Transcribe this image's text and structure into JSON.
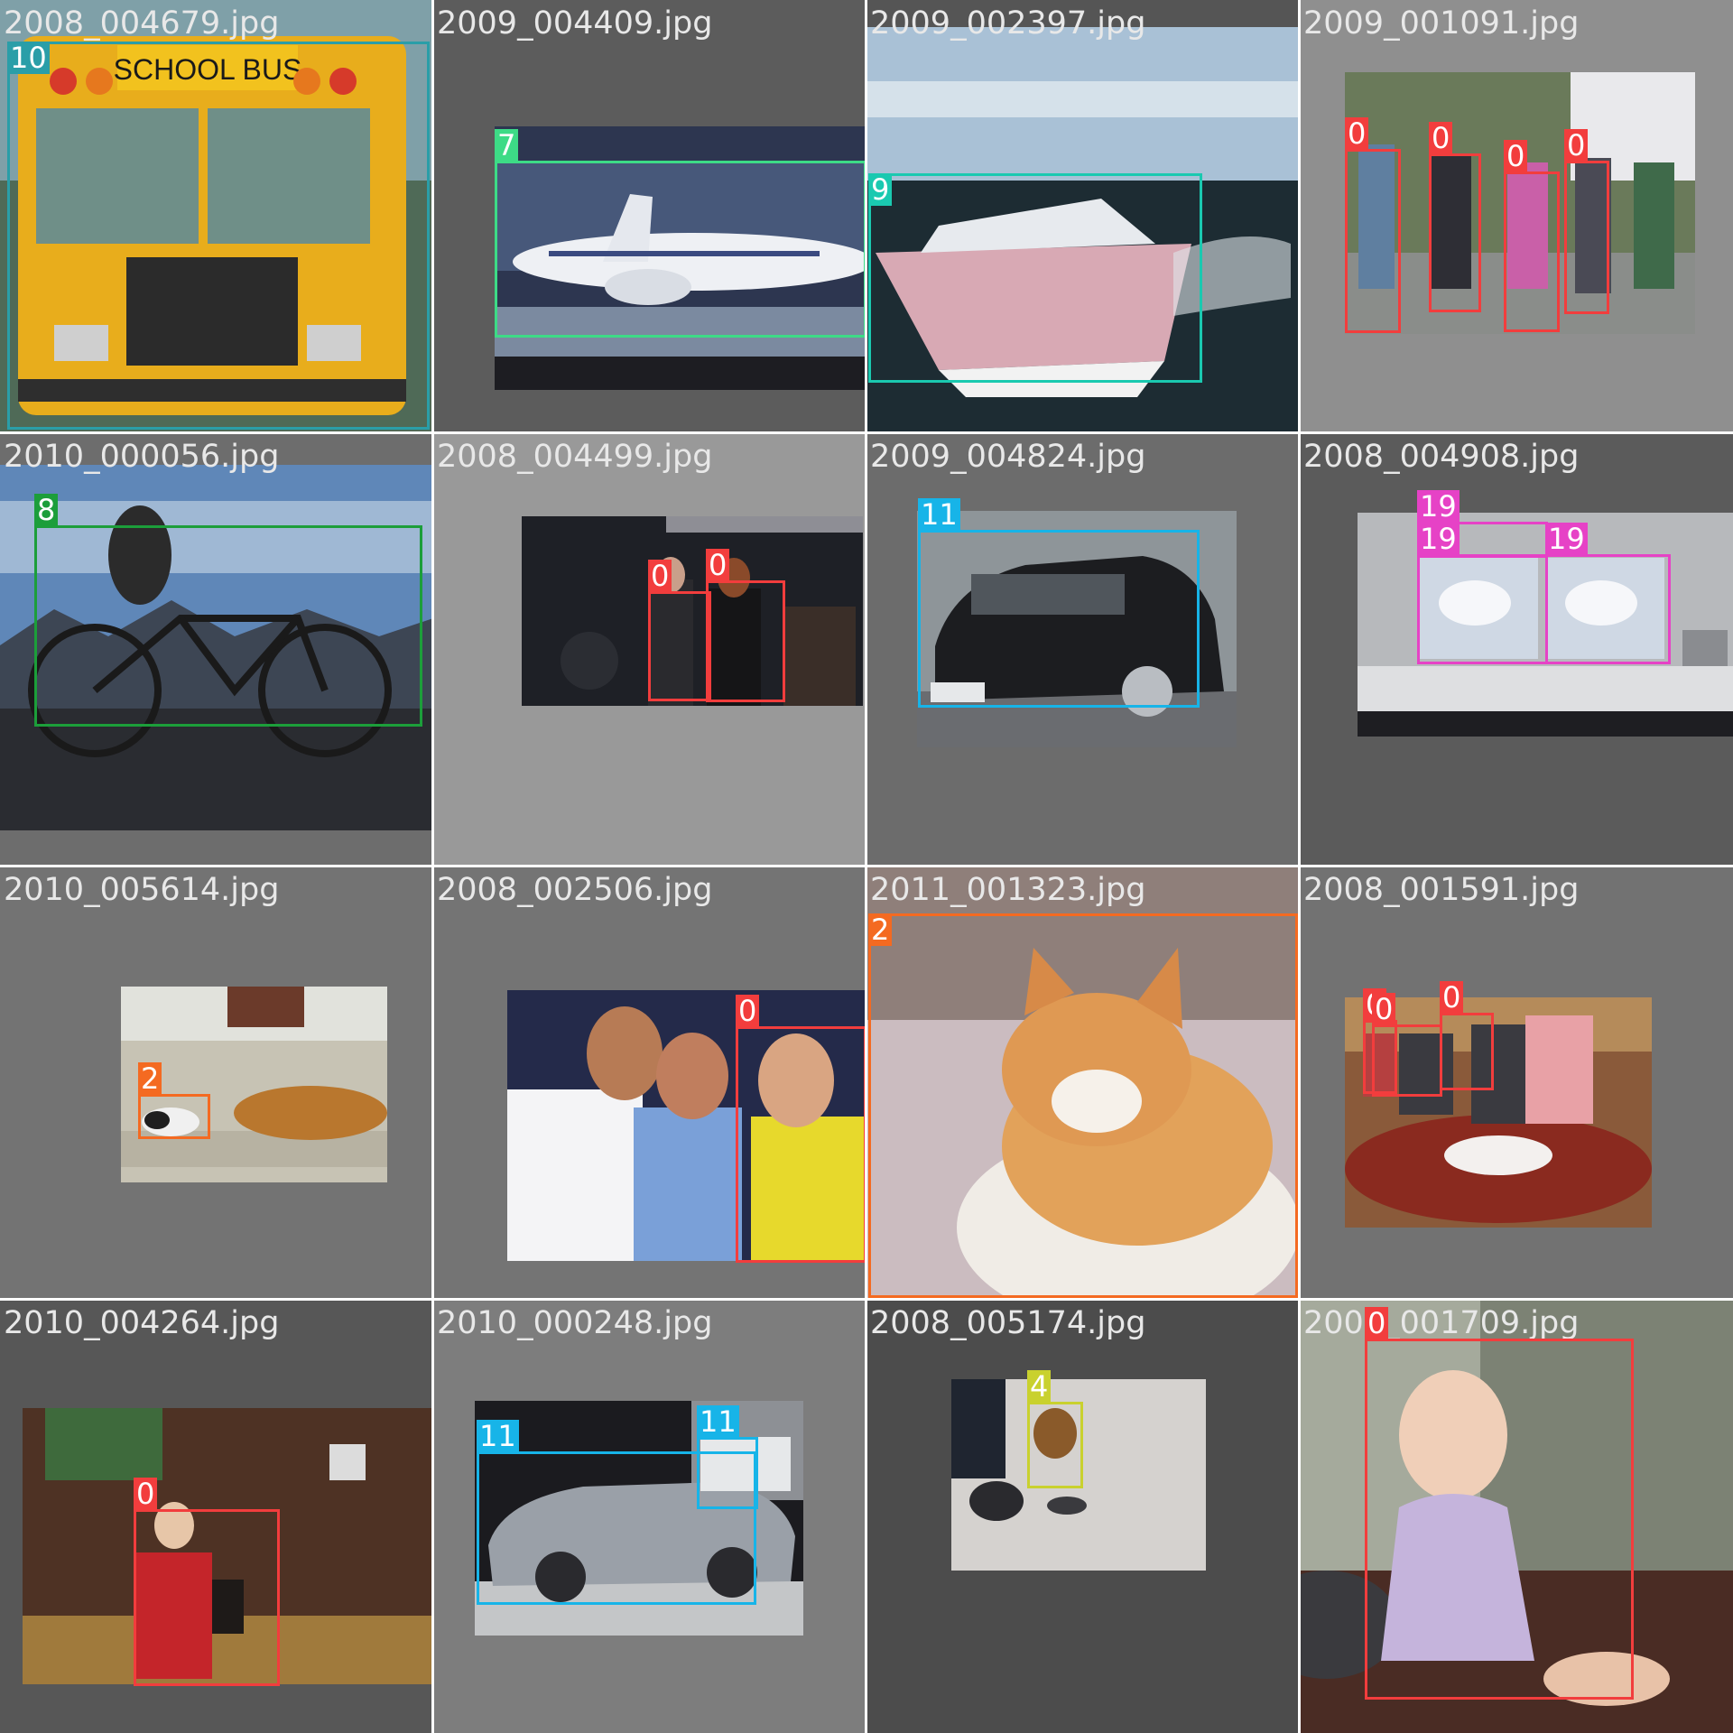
{
  "mosaic": {
    "tiles": [
      {
        "filename": "2008_004679.jpg",
        "subject": "yellow school bus, front view",
        "detections": [
          {
            "class_id": "10",
            "color": "#2a9ea8"
          }
        ]
      },
      {
        "filename": "2009_004409.jpg",
        "subject": "airliner on a runway",
        "detections": [
          {
            "class_id": "7",
            "color": "#3ddb86"
          }
        ]
      },
      {
        "filename": "2009_002397.jpg",
        "subject": "motor yacht at speed",
        "detections": [
          {
            "class_id": "9",
            "color": "#1ac9b0"
          }
        ]
      },
      {
        "filename": "2009_001091.jpg",
        "subject": "group of young people with luggage",
        "detections": [
          {
            "class_id": "0",
            "color": "#f23d3d"
          },
          {
            "class_id": "0",
            "color": "#f23d3d"
          },
          {
            "class_id": "0",
            "color": "#f23d3d"
          },
          {
            "class_id": "0",
            "color": "#f23d3d"
          }
        ]
      },
      {
        "filename": "2010_000056.jpg",
        "subject": "bicycle silhouette against sky",
        "detections": [
          {
            "class_id": "8",
            "color": "#1c9e3a"
          }
        ]
      },
      {
        "filename": "2008_004499.jpg",
        "subject": "people at a new year party",
        "detections": [
          {
            "class_id": "0",
            "color": "#f23d3d"
          },
          {
            "class_id": "0",
            "color": "#f23d3d"
          }
        ]
      },
      {
        "filename": "2009_004824.jpg",
        "subject": "black hatchback car",
        "detections": [
          {
            "class_id": "11",
            "color": "#17b4e8"
          }
        ]
      },
      {
        "filename": "2008_004908.jpg",
        "subject": "office desk with computer monitors",
        "detections": [
          {
            "class_id": "19",
            "color": "#e642c6"
          },
          {
            "class_id": "19",
            "color": "#e642c6"
          },
          {
            "class_id": "19",
            "color": "#e642c6"
          }
        ]
      },
      {
        "filename": "2010_005614.jpg",
        "subject": "dog and cat on a sofa",
        "detections": [
          {
            "class_id": "2",
            "color": "#f46a21"
          }
        ]
      },
      {
        "filename": "2008_002506.jpg",
        "subject": "three friends posing",
        "detections": [
          {
            "class_id": "0",
            "color": "#f23d3d"
          }
        ]
      },
      {
        "filename": "2011_001323.jpg",
        "subject": "sleepy ginger and white cat",
        "detections": [
          {
            "class_id": "2",
            "color": "#f46a21"
          }
        ]
      },
      {
        "filename": "2008_001591.jpg",
        "subject": "people at a round dinner table",
        "detections": [
          {
            "class_id": "0",
            "color": "#f23d3d"
          },
          {
            "class_id": "0",
            "color": "#f23d3d"
          },
          {
            "class_id": "0",
            "color": "#f23d3d"
          }
        ]
      },
      {
        "filename": "2010_004264.jpg",
        "subject": "girl in red jacket in a barn",
        "detections": [
          {
            "class_id": "0",
            "color": "#f23d3d"
          }
        ]
      },
      {
        "filename": "2010_000248.jpg",
        "subject": "silver roadster at a car show",
        "detections": [
          {
            "class_id": "11",
            "color": "#17b4e8"
          },
          {
            "class_id": "11",
            "color": "#17b4e8"
          }
        ]
      },
      {
        "filename": "2008_005174.jpg",
        "subject": "small dog in the snow",
        "detections": [
          {
            "class_id": "4",
            "color": "#c9d12e"
          }
        ]
      },
      {
        "filename": "2008_001709.jpg",
        "subject": "baby in a lilac dress on the floor",
        "detections": [
          {
            "class_id": "0",
            "color": "#f23d3d"
          }
        ]
      }
    ]
  }
}
